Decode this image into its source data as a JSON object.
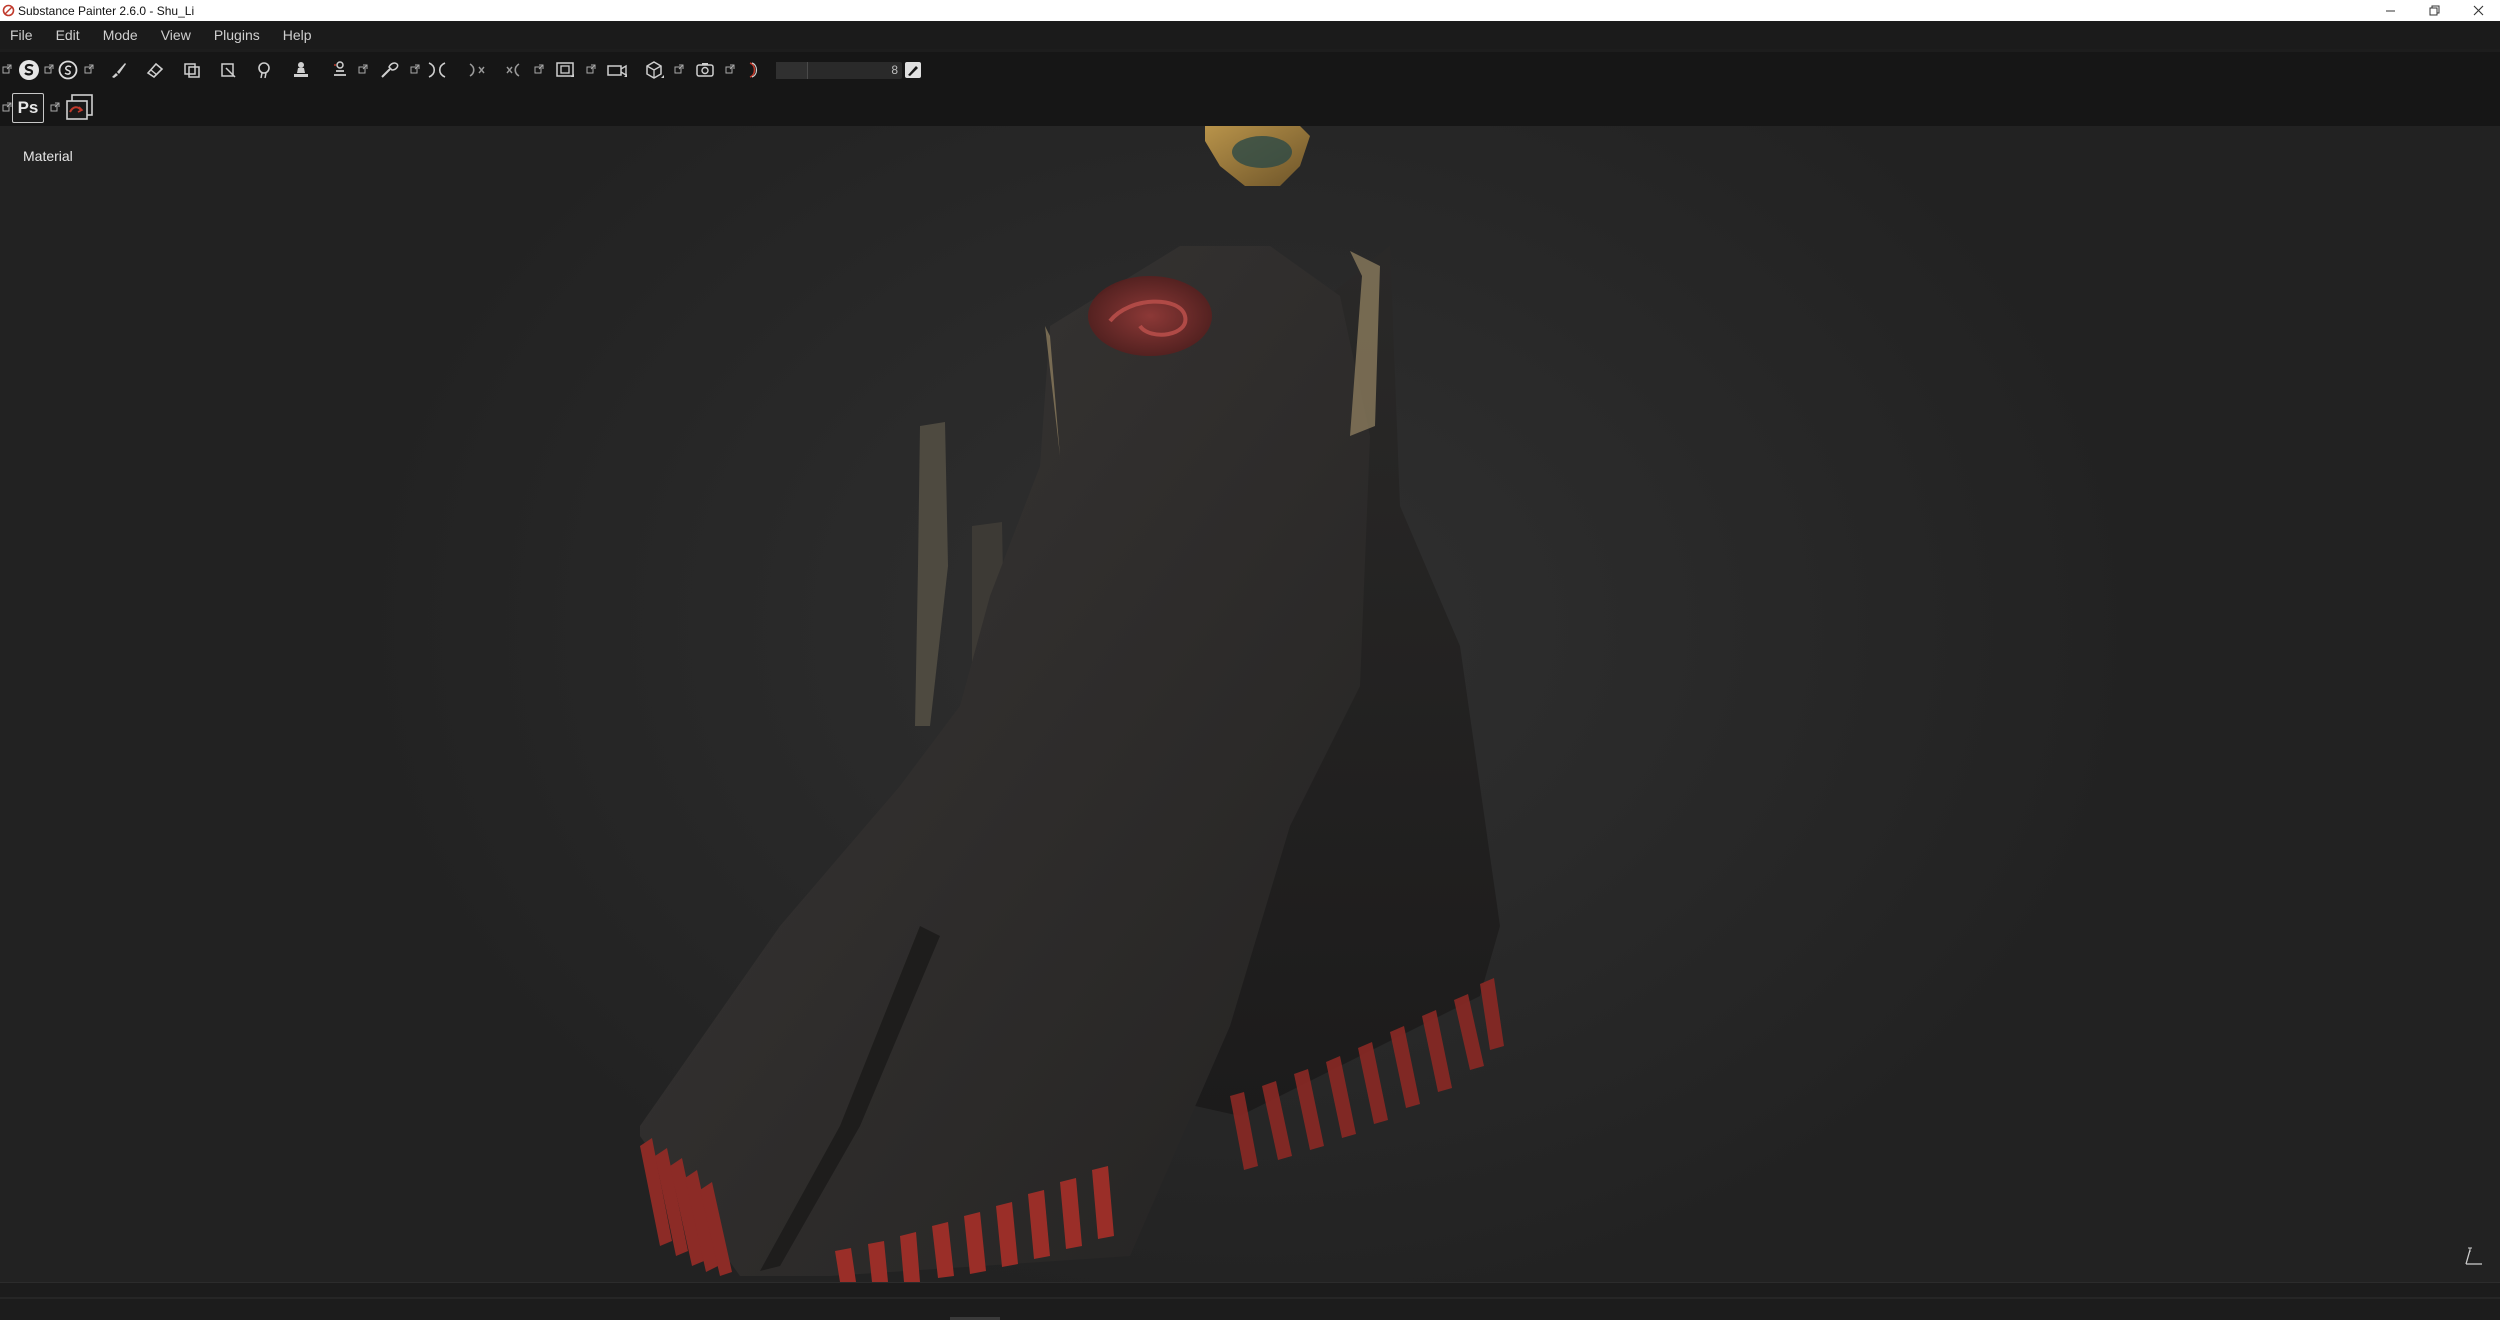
{
  "window": {
    "title": "Substance Painter 2.6.0 - Shu_Li"
  },
  "menu": {
    "items": [
      "File",
      "Edit",
      "Mode",
      "View",
      "Plugins",
      "Help"
    ]
  },
  "toolbar": {
    "tools": [
      "substance-logo-icon",
      "bake-sphere-icon",
      "paint-brush-icon",
      "eraser-icon",
      "projection-icon",
      "polygon-fill-icon",
      "smudge-icon",
      "clone-stamp-icon",
      "material-picker-icon",
      "color-picker-icon",
      "symmetry-icon",
      "mirror-icon",
      "viewport-icon",
      "camera-icon",
      "cube-icon",
      "screenshot-icon",
      "lasso-icon"
    ],
    "brush_size_value": "8",
    "brush_size_fraction": 0.25
  },
  "toolbar2": {
    "ps_label": "Ps"
  },
  "viewport": {
    "label": "Material"
  },
  "colors": {
    "accent_red": "#c0392b",
    "panel_bg": "#161616",
    "viewport_bg": "#2b2b2b"
  }
}
